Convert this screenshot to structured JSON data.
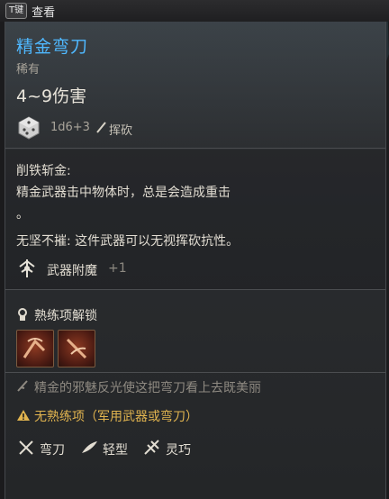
{
  "topbar": {
    "key": "T键",
    "label": "查看"
  },
  "item": {
    "name": "精金弯刀",
    "rarity": "稀有",
    "damage": "4~9伤害",
    "roll": "1d6+3",
    "damage_type": "挥砍"
  },
  "passive": {
    "line1": "削铁斩金:",
    "line2": "精金武器击中物体时，总是会造成重击",
    "line3": "。",
    "line4": "无坚不摧: 这件武器可以无视挥砍抗性。"
  },
  "enchant": {
    "label": "武器附魔",
    "value": "+1"
  },
  "proficiency": {
    "unlock_label": "熟练项解锁"
  },
  "flavor": {
    "text": "精金的邪魅反光使这把弯刀看上去既美丽"
  },
  "warning": {
    "text": "无熟练项（军用武器或弯刀）"
  },
  "tags": [
    "弯刀",
    "轻型",
    "灵巧"
  ],
  "colors": {
    "name": "#4fb8ff",
    "warning": "#e1b44f",
    "muted": "#a9a49a"
  }
}
